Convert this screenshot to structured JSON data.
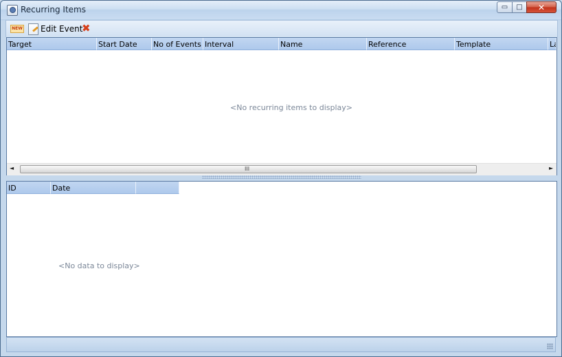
{
  "window": {
    "title": "Recurring Items",
    "controls": {
      "minimize": "▭",
      "maximize": "□",
      "close": "✕"
    }
  },
  "toolbar": {
    "new_label": "NEW",
    "edit_label": "Edit Event",
    "delete_icon": "✖"
  },
  "recurring_grid": {
    "columns": [
      "Target",
      "Start Date",
      "No of Events",
      "Interval",
      "Name",
      "Reference",
      "Template",
      "La"
    ],
    "empty_message": "<No recurring items to display>",
    "scrollbar": {
      "left_arrow": "◄",
      "right_arrow": "►",
      "grip": "III"
    }
  },
  "details_grid": {
    "columns": [
      "ID",
      "Date",
      ""
    ],
    "empty_message": "<No data to display>"
  },
  "colors": {
    "header_bg": "#b8d0ef",
    "border": "#5a7aa3",
    "empty_text": "#7b8798",
    "close_button": "#c1321b"
  }
}
